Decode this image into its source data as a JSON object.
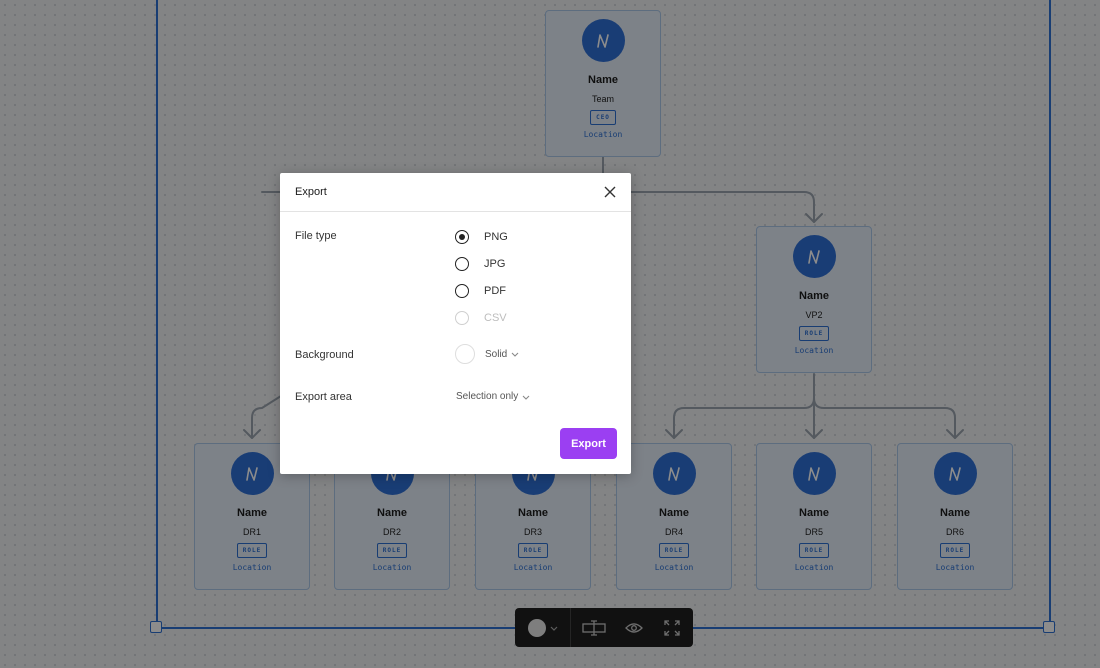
{
  "org_chart": {
    "root": {
      "name": "Name",
      "title": "Team",
      "role": "CEO",
      "location": "Location"
    },
    "vp2": {
      "name": "Name",
      "title": "VP2",
      "role": "ROLE",
      "location": "Location"
    },
    "reports": [
      {
        "name": "Name",
        "title": "DR1",
        "role": "ROLE",
        "location": "Location"
      },
      {
        "name": "Name",
        "title": "DR2",
        "role": "ROLE",
        "location": "Location"
      },
      {
        "name": "Name",
        "title": "DR3",
        "role": "ROLE",
        "location": "Location"
      },
      {
        "name": "Name",
        "title": "DR4",
        "role": "ROLE",
        "location": "Location"
      },
      {
        "name": "Name",
        "title": "DR5",
        "role": "ROLE",
        "location": "Location"
      },
      {
        "name": "Name",
        "title": "DR6",
        "role": "ROLE",
        "location": "Location"
      }
    ],
    "avatar_color": "#2f6fd6",
    "card_color": "#e3edf8",
    "frame_color": "#2d6fd2"
  },
  "export_dialog": {
    "title": "Export",
    "file_type_label": "File type",
    "file_types": [
      {
        "label": "PNG",
        "selected": true,
        "disabled": false
      },
      {
        "label": "JPG",
        "selected": false,
        "disabled": false
      },
      {
        "label": "PDF",
        "selected": false,
        "disabled": false
      },
      {
        "label": "CSV",
        "selected": false,
        "disabled": true
      }
    ],
    "background_label": "Background",
    "background_value": "Solid",
    "export_area_label": "Export area",
    "export_area_value": "Selection only",
    "export_button": "Export",
    "accent_color": "#9b3ff2"
  },
  "toolbar": {
    "icons": [
      "color-fill-icon",
      "chevron-down-icon",
      "text-resize-icon",
      "eye-icon",
      "fit-to-screen-icon"
    ]
  }
}
